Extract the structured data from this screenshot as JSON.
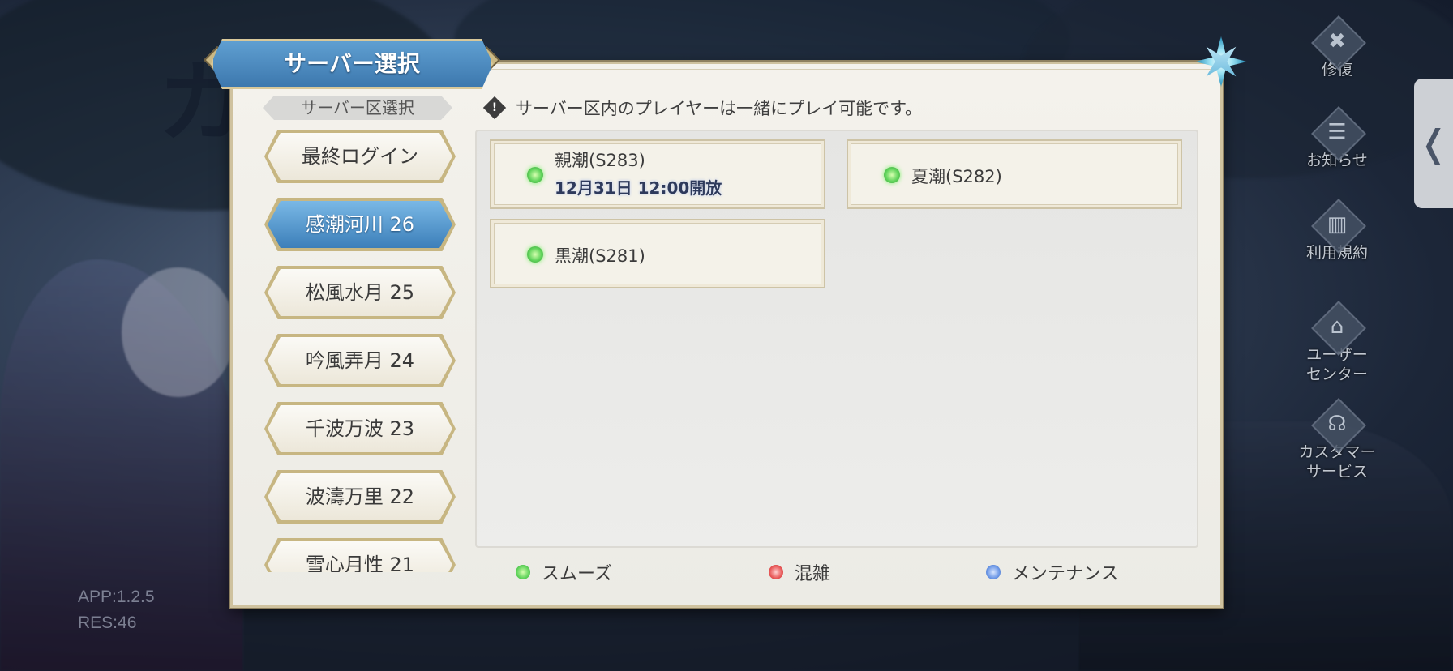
{
  "version": {
    "app": "APP:1.2.5",
    "res": "RES:46"
  },
  "side_menu": [
    {
      "label": "修復",
      "icon": "wrench-hammer-icon"
    },
    {
      "label": "お知らせ",
      "icon": "notice-board-icon"
    },
    {
      "label": "利用規約",
      "icon": "book-icon"
    },
    {
      "label": "ユーザー\nセンター",
      "icon": "castle-icon"
    },
    {
      "label": "カスタマー\nサービス",
      "icon": "headset-icon"
    }
  ],
  "edge_tab_glyph": "❬",
  "dialog": {
    "title": "サーバー選択",
    "region_header": "サーバー区選択",
    "notice": "サーバー区内のプレイヤーは一緒にプレイ可能です。",
    "notice_icon": "!"
  },
  "regions": [
    {
      "label": "最終ログイン",
      "active": false
    },
    {
      "label": "感潮河川 26",
      "active": true
    },
    {
      "label": "松風水月 25",
      "active": false
    },
    {
      "label": "吟風弄月 24",
      "active": false
    },
    {
      "label": "千波万波 23",
      "active": false
    },
    {
      "label": "波濤万里 22",
      "active": false
    },
    {
      "label": "雪心月性 21",
      "active": false
    }
  ],
  "servers": [
    {
      "name": "親潮(S283)",
      "open_time": "12月31日 12:00開放",
      "status": "smooth"
    },
    {
      "name": "夏潮(S282)",
      "open_time": "",
      "status": "smooth"
    },
    {
      "name": "黒潮(S281)",
      "open_time": "",
      "status": "smooth"
    }
  ],
  "legend": [
    {
      "label": "スムーズ",
      "color": "#5fd35a"
    },
    {
      "label": "混雑",
      "color": "#e85656"
    },
    {
      "label": "メンテナンス",
      "color": "#6a96e6"
    }
  ]
}
